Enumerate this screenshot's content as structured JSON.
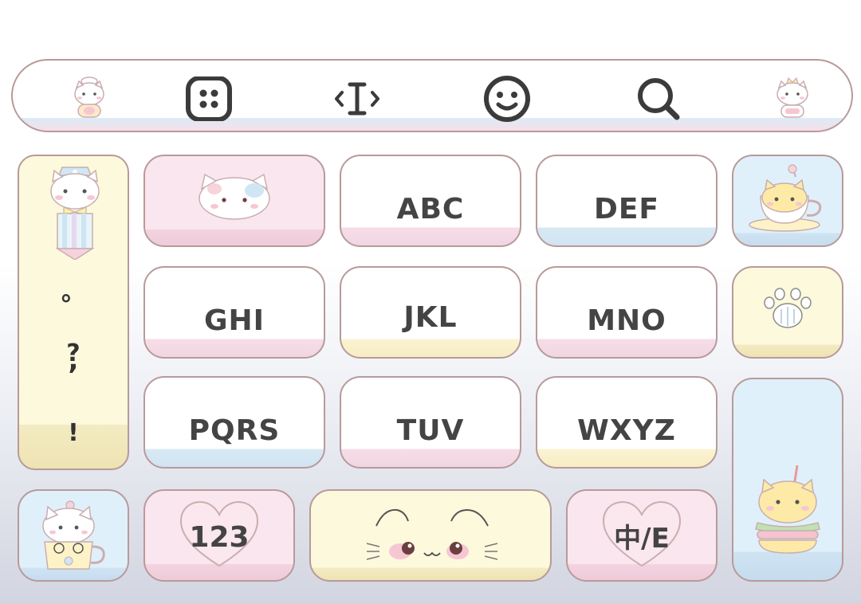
{
  "toolbar": {
    "icons": [
      "cat-chef-icon",
      "apps-grid-icon",
      "text-cursor-icon",
      "emoji-icon",
      "search-icon",
      "cat-crown-icon"
    ]
  },
  "keys": {
    "abc": "ABC",
    "def": "DEF",
    "ghi": "GHI",
    "jkl": "JKL",
    "mno": "MNO",
    "pqrs": "PQRS",
    "tuv": "TUV",
    "wxyz": "WXYZ",
    "numbers": "123",
    "lang_switch": "中/E"
  },
  "punctuation": [
    ",",
    "。",
    "?",
    "!"
  ],
  "colors": {
    "outline": "#b89a9a",
    "text": "#444444",
    "pink": "#fae6ee",
    "yellow": "#fdf9dc",
    "blue": "#e0f0fa"
  }
}
